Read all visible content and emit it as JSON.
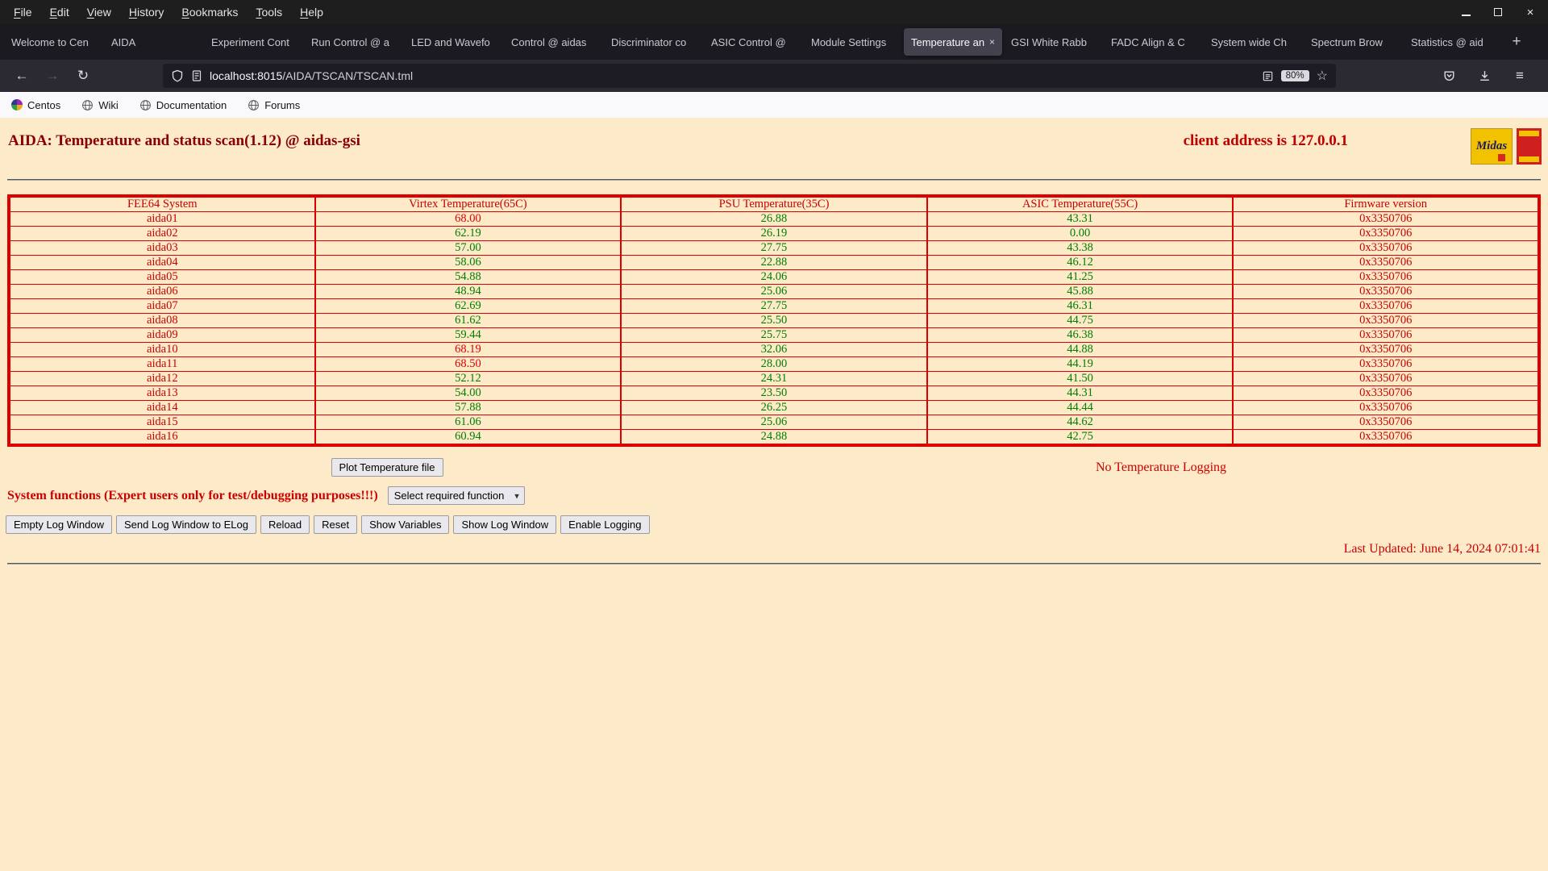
{
  "icons": {
    "back": "←",
    "forward": "→",
    "reload": "↻",
    "star": "☆",
    "menu": "≡",
    "plus": "+",
    "close": "×",
    "tab_close": "×"
  },
  "colors": {
    "page_bg": "#fceac9",
    "table_border": "#dd0000",
    "ok_green": "#008000",
    "alarm_red": "#dd0000",
    "title_red": "#8b0000",
    "text_red": "#cc0000"
  },
  "browser": {
    "menu": [
      "File",
      "Edit",
      "View",
      "History",
      "Bookmarks",
      "Tools",
      "Help"
    ],
    "tabs": [
      {
        "label": "Welcome to Cen",
        "active": false
      },
      {
        "label": "AIDA",
        "active": false
      },
      {
        "label": "Experiment Cont",
        "active": false
      },
      {
        "label": "Run Control @ a",
        "active": false
      },
      {
        "label": "LED and Wavefo",
        "active": false
      },
      {
        "label": "Control @ aidas",
        "active": false
      },
      {
        "label": "Discriminator co",
        "active": false
      },
      {
        "label": "ASIC Control @",
        "active": false
      },
      {
        "label": "Module Settings",
        "active": false
      },
      {
        "label": "Temperature an",
        "active": true
      },
      {
        "label": "GSI White Rabb",
        "active": false
      },
      {
        "label": "FADC Align & C",
        "active": false
      },
      {
        "label": "System wide Ch",
        "active": false
      },
      {
        "label": "Spectrum Brow",
        "active": false
      },
      {
        "label": "Statistics @ aid",
        "active": false
      }
    ],
    "nav": {
      "url_host": "localhost:8015",
      "url_path": "/AIDA/TSCAN/TSCAN.tml",
      "zoom": "80%"
    },
    "bookmarks": [
      "Centos",
      "Wiki",
      "Documentation",
      "Forums"
    ]
  },
  "page": {
    "title": "AIDA: Temperature and status scan(1.12) @ aidas-gsi",
    "client_address": "client address is 127.0.0.1",
    "logo_text": "Midas",
    "table": {
      "headers": [
        "FEE64 System",
        "Virtex Temperature(65C)",
        "PSU Temperature(35C)",
        "ASIC Temperature(55C)",
        "Firmware version"
      ],
      "thresholds": {
        "virtex": 65,
        "psu": 35,
        "asic": 55
      },
      "rows": [
        {
          "system": "aida01",
          "virtex": "68.00",
          "psu": "26.88",
          "asic": "43.31",
          "firmware": "0x3350706"
        },
        {
          "system": "aida02",
          "virtex": "62.19",
          "psu": "26.19",
          "asic": "0.00",
          "firmware": "0x3350706"
        },
        {
          "system": "aida03",
          "virtex": "57.00",
          "psu": "27.75",
          "asic": "43.38",
          "firmware": "0x3350706"
        },
        {
          "system": "aida04",
          "virtex": "58.06",
          "psu": "22.88",
          "asic": "46.12",
          "firmware": "0x3350706"
        },
        {
          "system": "aida05",
          "virtex": "54.88",
          "psu": "24.06",
          "asic": "41.25",
          "firmware": "0x3350706"
        },
        {
          "system": "aida06",
          "virtex": "48.94",
          "psu": "25.06",
          "asic": "45.88",
          "firmware": "0x3350706"
        },
        {
          "system": "aida07",
          "virtex": "62.69",
          "psu": "27.75",
          "asic": "46.31",
          "firmware": "0x3350706"
        },
        {
          "system": "aida08",
          "virtex": "61.62",
          "psu": "25.50",
          "asic": "44.75",
          "firmware": "0x3350706"
        },
        {
          "system": "aida09",
          "virtex": "59.44",
          "psu": "25.75",
          "asic": "46.38",
          "firmware": "0x3350706"
        },
        {
          "system": "aida10",
          "virtex": "68.19",
          "psu": "32.06",
          "asic": "44.88",
          "firmware": "0x3350706"
        },
        {
          "system": "aida11",
          "virtex": "68.50",
          "psu": "28.00",
          "asic": "44.19",
          "firmware": "0x3350706"
        },
        {
          "system": "aida12",
          "virtex": "52.12",
          "psu": "24.31",
          "asic": "41.50",
          "firmware": "0x3350706"
        },
        {
          "system": "aida13",
          "virtex": "54.00",
          "psu": "23.50",
          "asic": "44.31",
          "firmware": "0x3350706"
        },
        {
          "system": "aida14",
          "virtex": "57.88",
          "psu": "26.25",
          "asic": "44.44",
          "firmware": "0x3350706"
        },
        {
          "system": "aida15",
          "virtex": "61.06",
          "psu": "25.06",
          "asic": "44.62",
          "firmware": "0x3350706"
        },
        {
          "system": "aida16",
          "virtex": "60.94",
          "psu": "24.88",
          "asic": "42.75",
          "firmware": "0x3350706"
        }
      ]
    },
    "plot_button": "Plot Temperature file",
    "logging_status": "No Temperature Logging",
    "system_functions": "System functions (Expert users only for test/debugging purposes!!!)",
    "function_select": "Select required function",
    "action_buttons": [
      "Empty Log Window",
      "Send Log Window to ELog",
      "Reload",
      "Reset",
      "Show Variables",
      "Show Log Window",
      "Enable Logging"
    ],
    "last_updated": "Last Updated: June 14, 2024 07:01:41"
  }
}
